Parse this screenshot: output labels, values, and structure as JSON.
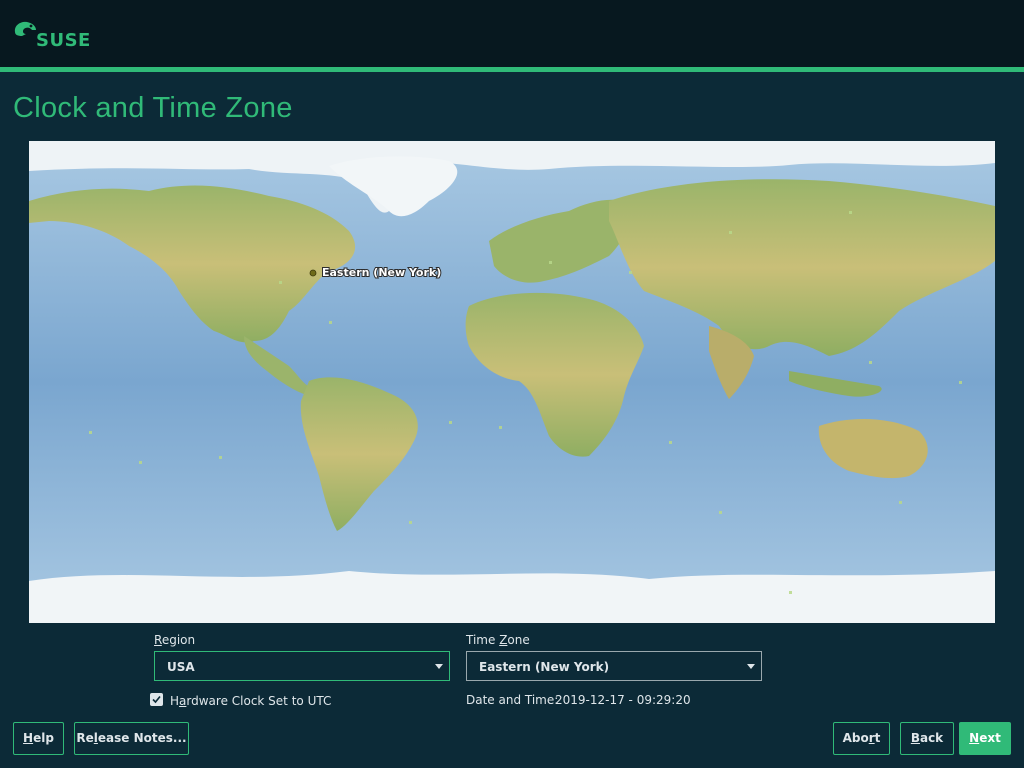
{
  "header": {
    "logo_text": "SUSE",
    "accent_color": "#30ba78",
    "background_color": "#07181f"
  },
  "page": {
    "title": "Clock and Time Zone"
  },
  "map": {
    "marker_label": "Eastern (New York)",
    "marker_icon": "location-dot-icon"
  },
  "region": {
    "label_pre": "",
    "label_mnemonic": "R",
    "label_post": "egion",
    "value": "USA"
  },
  "timezone": {
    "label_pre": "Time ",
    "label_mnemonic": "Z",
    "label_post": "one",
    "value": "Eastern (New York)"
  },
  "hardware_clock": {
    "checked": true,
    "label_pre": "H",
    "label_mnemonic": "a",
    "label_post": "rdware Clock Set to UTC"
  },
  "datetime": {
    "label": "Date and Time:",
    "value": "2019-12-17 - 09:29:20"
  },
  "buttons": {
    "help": {
      "pre": "",
      "mn": "H",
      "post": "elp"
    },
    "release_notes": {
      "pre": "Re",
      "mn": "l",
      "post": "ease Notes..."
    },
    "abort": {
      "pre": "Abo",
      "mn": "r",
      "post": "t"
    },
    "back": {
      "pre": "",
      "mn": "B",
      "post": "ack"
    },
    "next": {
      "pre": "",
      "mn": "N",
      "post": "ext"
    }
  }
}
